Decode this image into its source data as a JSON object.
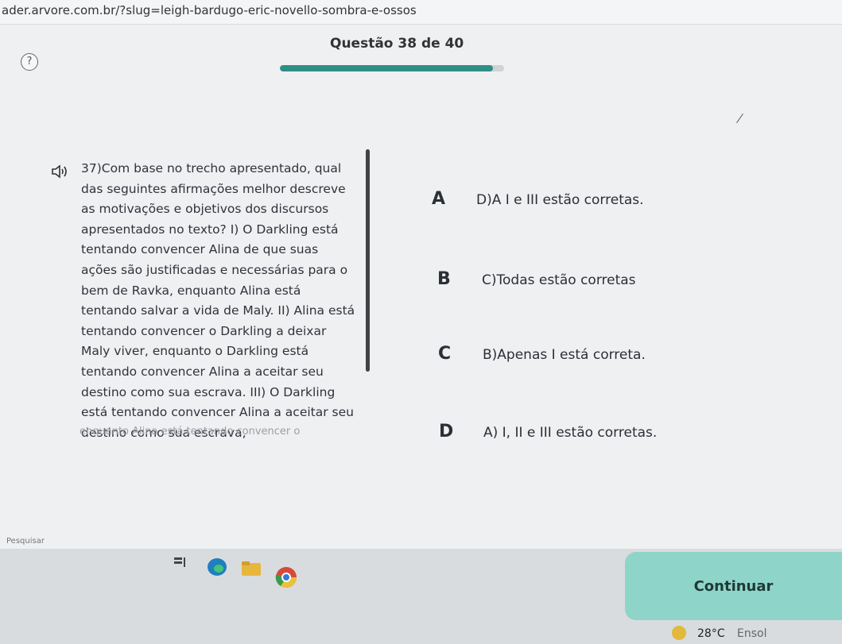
{
  "browser": {
    "url": "ader.arvore.com.br/?slug=leigh-bardugo-eric-novello-sombra-e-ossos"
  },
  "header": {
    "help_icon": "?",
    "question_counter": "Questão 38 de 40",
    "progress": 0.95
  },
  "question": {
    "audio_icon": "speaker-icon",
    "text": "37)Com base no trecho apresentado, qual das seguintes afirmações melhor descreve as motivações e objetivos dos discursos apresentados no texto? I) O Darkling está tentando convencer Alina de que suas ações são justificadas e necessárias para o bem de Ravka, enquanto Alina está tentando salvar a vida de Maly. II) Alina está tentando convencer o Darkling a deixar Maly viver, enquanto o Darkling está tentando convencer Alina a aceitar seu destino como sua escrava. III) O Darkling está tentando convencer Alina a aceitar seu destino como sua escrava,",
    "text_cut": "enquanto Alina está tentando convencer o"
  },
  "options": [
    {
      "letter": "A",
      "text": "D)A I e III estão corretas."
    },
    {
      "letter": "B",
      "text": "C)Todas estão corretas"
    },
    {
      "letter": "C",
      "text": "B)Apenas I está correta."
    },
    {
      "letter": "D",
      "text": "A) I, II e III estão corretas."
    }
  ],
  "footer": {
    "continue_label": "Continuar"
  },
  "taskbar": {
    "search_placeholder": "Pesquisar",
    "temperature": "28°C",
    "condition": "Ensol"
  },
  "colors": {
    "accent": "#2e8f86",
    "continue_bg": "#8fd4c9"
  }
}
